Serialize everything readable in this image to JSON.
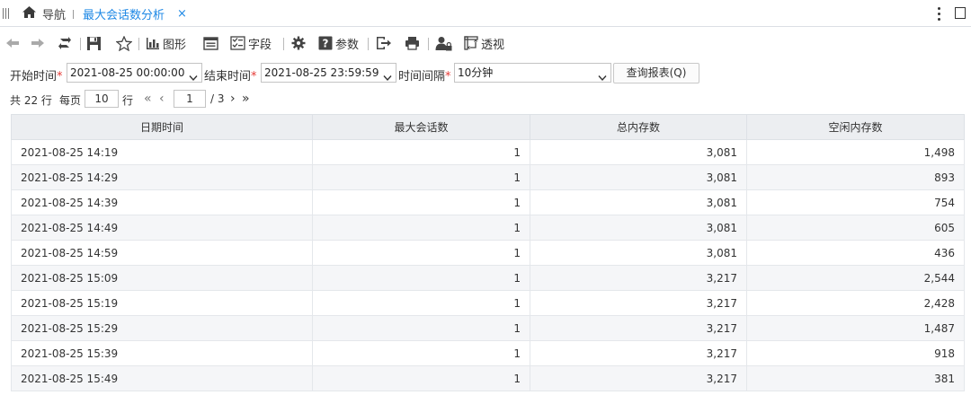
{
  "tabs": {
    "home_label": "导航",
    "active_label": "最大会话数分析",
    "close_glyph": "×"
  },
  "toolbar": {
    "chart_label": "图形",
    "fields_label": "字段",
    "params_label": "参数",
    "pivot_label": "透视"
  },
  "query": {
    "start_label": "开始时间",
    "start_value": "2021-08-25 00:00:00",
    "end_label": "结束时间",
    "end_value": "2021-08-25 23:59:59",
    "interval_label": "时间间隔",
    "interval_value": "10分钟",
    "required_mark": "*",
    "query_button": "查询报表(Q)"
  },
  "pager": {
    "total_text": "共 22 行",
    "per_page_label": "每页",
    "per_page_value": "10",
    "rows_unit": "行",
    "current_page": "1",
    "total_pages": "/ 3"
  },
  "table": {
    "headers": [
      "日期时间",
      "最大会话数",
      "总内存数",
      "空闲内存数"
    ],
    "rows": [
      [
        "2021-08-25  14:19",
        "1",
        "3,081",
        "1,498"
      ],
      [
        "2021-08-25  14:29",
        "1",
        "3,081",
        "893"
      ],
      [
        "2021-08-25  14:39",
        "1",
        "3,081",
        "754"
      ],
      [
        "2021-08-25  14:49",
        "1",
        "3,081",
        "605"
      ],
      [
        "2021-08-25  14:59",
        "1",
        "3,081",
        "436"
      ],
      [
        "2021-08-25  15:09",
        "1",
        "3,217",
        "2,544"
      ],
      [
        "2021-08-25  15:19",
        "1",
        "3,217",
        "2,428"
      ],
      [
        "2021-08-25  15:29",
        "1",
        "3,217",
        "1,487"
      ],
      [
        "2021-08-25  15:39",
        "1",
        "3,217",
        "918"
      ],
      [
        "2021-08-25  15:49",
        "1",
        "3,217",
        "381"
      ]
    ]
  },
  "colors": {
    "accent": "#1e88e5",
    "required": "#e53935",
    "header_bg": "#eceef1",
    "alt_row_bg": "#f5f6f8"
  }
}
